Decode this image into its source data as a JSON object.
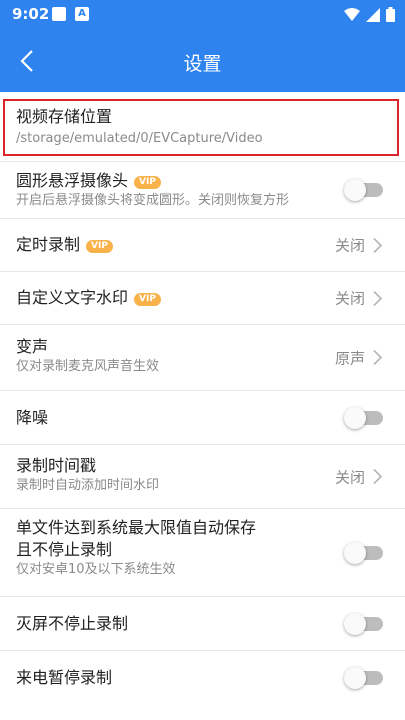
{
  "status_bar": {
    "time": "9:02",
    "a_icon_letter": "A"
  },
  "header": {
    "title": "设置"
  },
  "settings": [
    {
      "label": "视频存储位置",
      "sub": "/storage/emulated/0/EVCapture/Video"
    },
    {
      "label": "圆形悬浮摄像头",
      "vip": "VIP",
      "sub": "开启后悬浮摄像头将变成圆形。关闭则恢复方形",
      "toggle": false
    },
    {
      "label": "定时录制",
      "vip": "VIP",
      "value": "关闭"
    },
    {
      "label": "自定义文字水印",
      "vip": "VIP",
      "value": "关闭"
    },
    {
      "label": "变声",
      "sub": "仅对录制麦克风声音生效",
      "value": "原声"
    },
    {
      "label": "降噪",
      "toggle": false
    },
    {
      "label": "录制时间戳",
      "sub": "录制时自动添加时间水印",
      "value": "关闭"
    },
    {
      "label": "单文件达到系统最大限值自动保存",
      "label2": "且不停止录制",
      "sub": "仅对安卓10及以下系统生效",
      "toggle": false
    },
    {
      "label": "灭屏不停止录制",
      "toggle": false
    },
    {
      "label": "来电暂停录制",
      "toggle": false
    }
  ],
  "colors": {
    "accent": "#2e83ee",
    "vip": "#f9b24a",
    "highlight": "#d9262c",
    "toggle_off": "#bdbdbd"
  }
}
